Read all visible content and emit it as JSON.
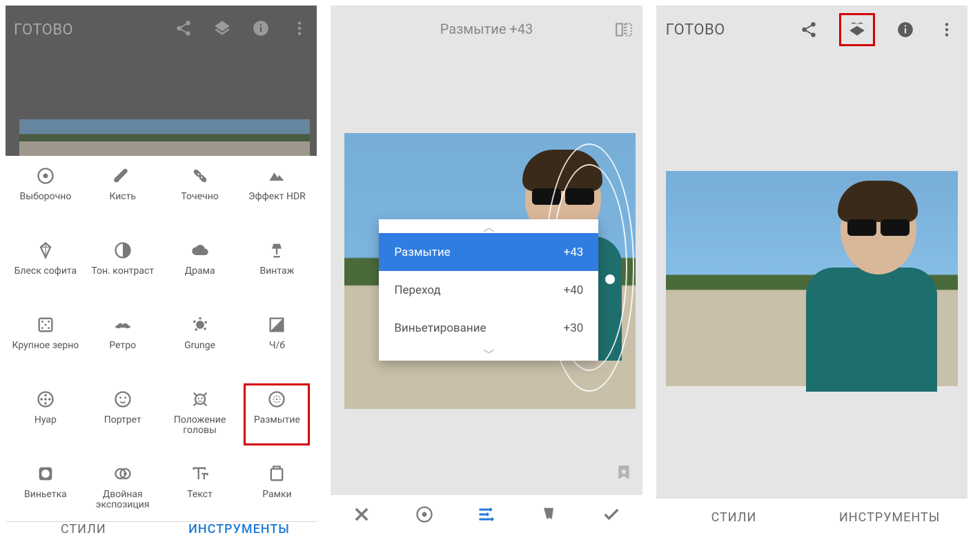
{
  "screen1": {
    "done_label": "ГОТОВО",
    "tools": [
      {
        "label": "Выборочно",
        "icon": "target"
      },
      {
        "label": "Кисть",
        "icon": "brush"
      },
      {
        "label": "Точечно",
        "icon": "bandage"
      },
      {
        "label": "Эффект HDR",
        "icon": "mountains"
      },
      {
        "label": "Блеск софита",
        "icon": "diamond"
      },
      {
        "label": "Тон. контраст",
        "icon": "contrast"
      },
      {
        "label": "Драма",
        "icon": "cloud"
      },
      {
        "label": "Винтаж",
        "icon": "lamp"
      },
      {
        "label": "Крупное зерно",
        "icon": "grain"
      },
      {
        "label": "Ретро",
        "icon": "mustache"
      },
      {
        "label": "Grunge",
        "icon": "splat"
      },
      {
        "label": "Ч/б",
        "icon": "bw"
      },
      {
        "label": "Нуар",
        "icon": "reel"
      },
      {
        "label": "Портрет",
        "icon": "face"
      },
      {
        "label": "Положение головы",
        "icon": "headpose"
      },
      {
        "label": "Размытие",
        "icon": "blur",
        "highlight": true
      },
      {
        "label": "Виньетка",
        "icon": "vignette"
      },
      {
        "label": "Двойная экспозиция",
        "icon": "double"
      },
      {
        "label": "Текст",
        "icon": "text"
      },
      {
        "label": "Рамки",
        "icon": "frame"
      }
    ],
    "tabs": {
      "styles": "СТИЛИ",
      "tools": "ИНСТРУМЕНТЫ"
    }
  },
  "screen2": {
    "header": {
      "param": "Размытие",
      "value": "+43"
    },
    "menu": [
      {
        "label": "Размытие",
        "value": "+43",
        "active": true
      },
      {
        "label": "Переход",
        "value": "+40"
      },
      {
        "label": "Виньетирование",
        "value": "+30"
      }
    ],
    "toolbar_icons": [
      "close",
      "center",
      "sliders",
      "styles",
      "check"
    ]
  },
  "screen3": {
    "done_label": "ГОТОВО",
    "tabs": {
      "styles": "СТИЛИ",
      "tools": "ИНСТРУМЕНТЫ"
    }
  }
}
